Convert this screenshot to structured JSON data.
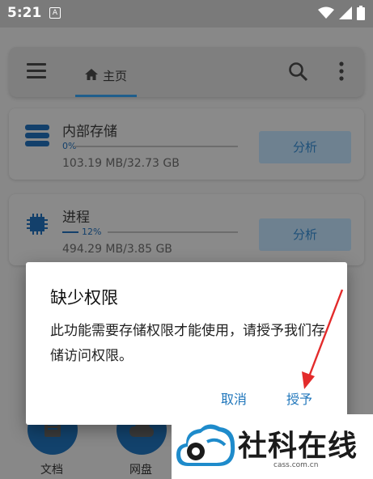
{
  "status_bar": {
    "time": "5:21",
    "notification_glyph": "A"
  },
  "app_bar": {
    "tab_label": "主页"
  },
  "storage_card": {
    "title": "内部存储",
    "percent": "0%",
    "size": "103.19 MB/32.73 GB",
    "analyze_label": "分析",
    "usage_fraction": 0.0
  },
  "process_card": {
    "title": "进程",
    "percent": "12%",
    "size": "494.29 MB/3.85 GB",
    "analyze_label": "分析",
    "usage_fraction": 0.12
  },
  "categories": [
    {
      "label": "文档",
      "icon": "document-icon"
    },
    {
      "label": "网盘",
      "icon": "cloud-icon"
    }
  ],
  "dialog": {
    "title": "缺少权限",
    "message": "此功能需要存储权限才能使用，请授予我们存储访问权限。",
    "cancel_label": "取消",
    "grant_label": "授予"
  },
  "watermark": {
    "title": "社科在线",
    "subtitle": "cass.com.cn"
  },
  "colors": {
    "accent": "#1f76bb",
    "arrow": "#e32b2b",
    "scrim": "#888888"
  }
}
